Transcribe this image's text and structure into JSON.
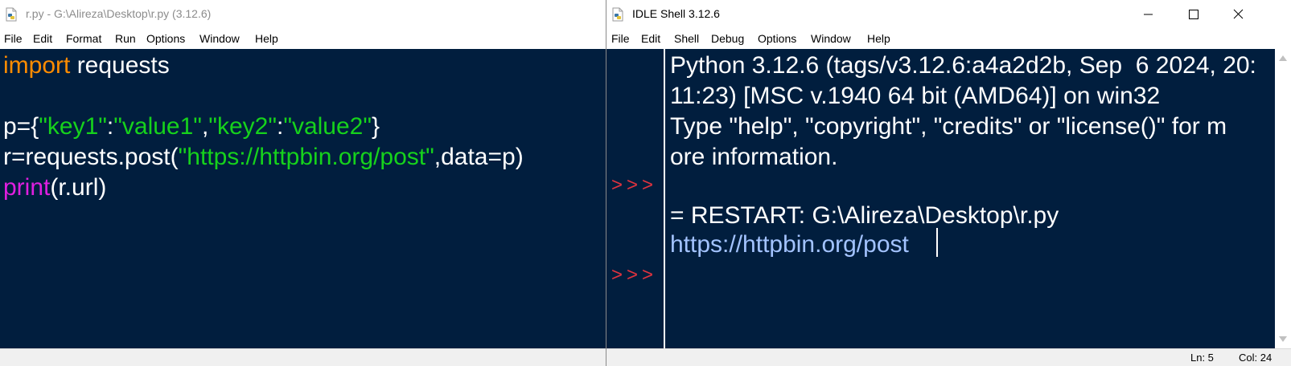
{
  "editor": {
    "title": "r.py - G:\\Alireza\\Desktop\\r.py (3.12.6)",
    "menu": [
      "File",
      "Edit",
      "Format",
      "Run",
      "Options",
      "Window",
      "Help"
    ],
    "code": {
      "line1": {
        "keyword": "import",
        "rest": " requests"
      },
      "line3": {
        "p1": "p={",
        "s1": "\"key1\"",
        "p2": ":",
        "s2": "\"value1\"",
        "p3": ",",
        "s3": "\"key2\"",
        "p4": ":",
        "s4": "\"value2\"",
        "p5": "}"
      },
      "line4": {
        "p1": "r=requests.post(",
        "s1": "\"https://httpbin.org/post\"",
        "p2": ",data=p)"
      },
      "line5": {
        "builtin": "print",
        "rest": "(r.url)"
      }
    }
  },
  "shell": {
    "title": "IDLE Shell 3.12.6",
    "menu": [
      "File",
      "Edit",
      "Shell",
      "Debug",
      "Options",
      "Window",
      "Help"
    ],
    "prompt": ">>>",
    "lines": [
      "Python 3.12.6 (tags/v3.12.6:a4a2d2b, Sep  6 2024, 20:",
      "11:23) [MSC v.1940 64 bit (AMD64)] on win32",
      "Type \"help\", \"copyright\", \"credits\" or \"license()\" for m",
      "ore information.",
      "= RESTART: G:\\Alireza\\Desktop\\r.py",
      "https://httpbin.org/post"
    ],
    "status": {
      "ln": "Ln: 5",
      "col": "Col: 24"
    }
  },
  "colors": {
    "background": "#011e3e",
    "keyword": "#ff8c00",
    "string": "#16d21c",
    "builtin": "#e01fe0",
    "prompt": "#e0333e",
    "output": "#a3c3ff"
  }
}
